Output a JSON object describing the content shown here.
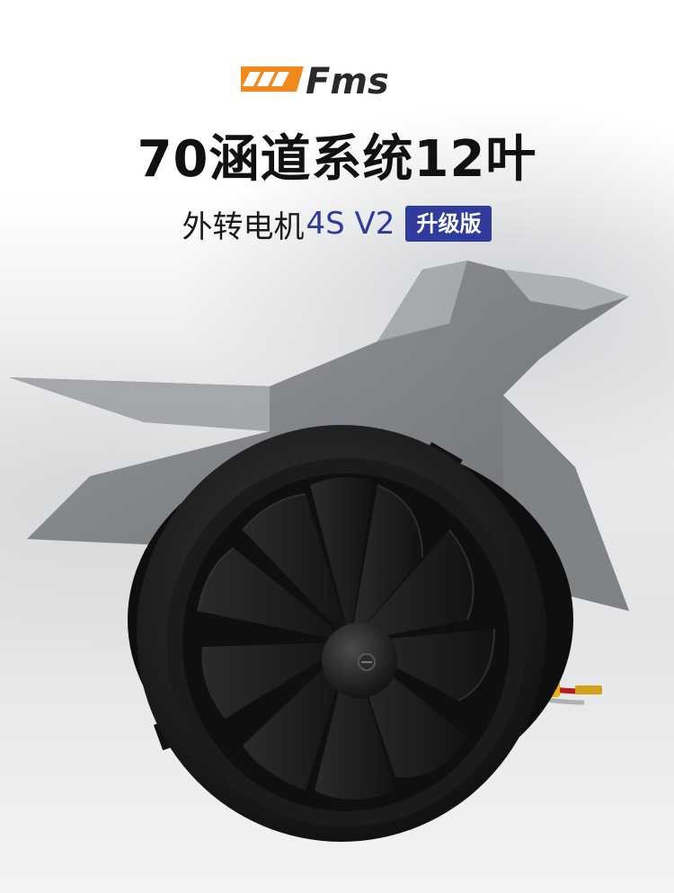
{
  "brand": {
    "logo_text": "Fms",
    "logo_color": "#f08a1c",
    "text_color": "#2a2a2a"
  },
  "title": "70涵道系统12叶",
  "subtitle": {
    "prefix": "外转电机",
    "model": "4S V2",
    "badge": "升级版"
  },
  "colors": {
    "accent_blue": "#2f3c9c",
    "fan_black": "#141414"
  }
}
